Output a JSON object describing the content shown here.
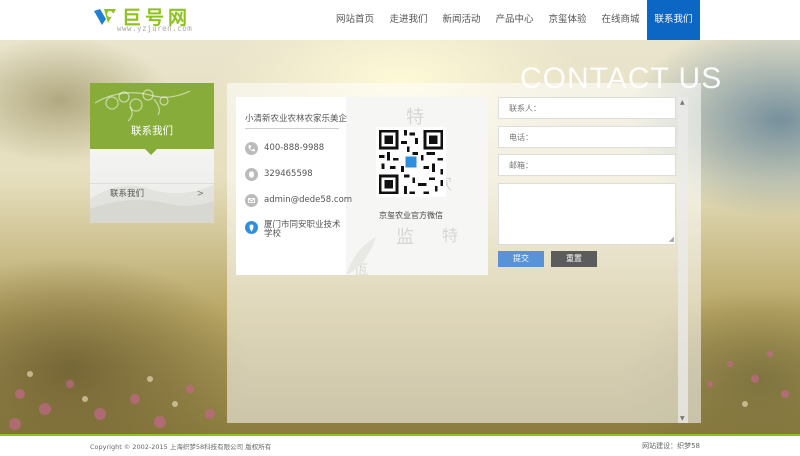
{
  "header": {
    "logo_text": "巨号网",
    "logo_url": "www.yzjuren.com",
    "nav": [
      {
        "label": "网站首页"
      },
      {
        "label": "走进我们"
      },
      {
        "label": "新闻活动"
      },
      {
        "label": "产品中心"
      },
      {
        "label": "京玺体验"
      },
      {
        "label": "在线商城"
      },
      {
        "label": "联系我们",
        "active": true
      }
    ]
  },
  "hero": {
    "title": "CONTACT US"
  },
  "sidebar": {
    "title": "联系我们",
    "items": [
      {
        "label": "联系我们",
        "arrow": ">"
      }
    ]
  },
  "contact": {
    "company": "小清新农业农林农家乐美企",
    "phone": "400-888-9988",
    "qq": "329465598",
    "email": "admin@dede58.com",
    "address": "厦门市同安职业技术学校",
    "qr_label": "京玺农业官方微信"
  },
  "form": {
    "name_placeholder": "联系人：",
    "phone_placeholder": "电话：",
    "email_placeholder": "邮箱：",
    "submit_label": "提交",
    "reset_label": "重置"
  },
  "footer": {
    "copyright": "Copyright © 2002-2015 上海织梦58科技有限公司 版权所有",
    "builder": "网站建设：织梦58"
  },
  "colors": {
    "brand_green": "#8dc21f",
    "nav_active": "#0b67c3",
    "sidebar_green": "#88ac3a",
    "submit_blue": "#5793d5",
    "reset_gray": "#5c5c5c"
  }
}
